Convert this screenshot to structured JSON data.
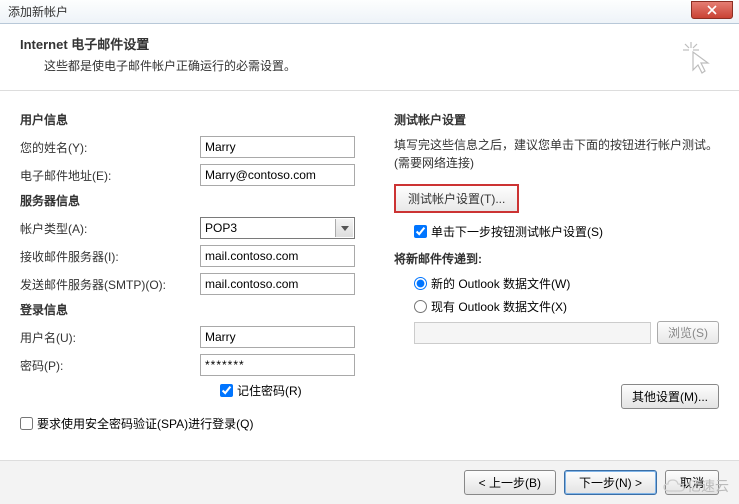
{
  "window": {
    "title": "添加新帐户"
  },
  "header": {
    "title": "Internet 电子邮件设置",
    "subtitle": "这些都是使电子邮件帐户正确运行的必需设置。"
  },
  "left": {
    "section_user": "用户信息",
    "name_label": "您的姓名(Y):",
    "name_value": "Marry",
    "email_label": "电子邮件地址(E):",
    "email_value": "Marry@contoso.com",
    "section_server": "服务器信息",
    "acct_type_label": "帐户类型(A):",
    "acct_type_value": "POP3",
    "incoming_label": "接收邮件服务器(I):",
    "incoming_value": "mail.contoso.com",
    "outgoing_label": "发送邮件服务器(SMTP)(O):",
    "outgoing_value": "mail.contoso.com",
    "section_login": "登录信息",
    "user_label": "用户名(U):",
    "user_value": "Marry",
    "pw_label": "密码(P):",
    "pw_value": "*******",
    "remember_pw": "记住密码(R)",
    "spa_label": "要求使用安全密码验证(SPA)进行登录(Q)"
  },
  "right": {
    "section_test": "测试帐户设置",
    "test_desc": "填写完这些信息之后，建议您单击下面的按钮进行帐户测试。(需要网络连接)",
    "test_btn": "测试帐户设置(T)...",
    "test_auto": "单击下一步按钮测试帐户设置(S)",
    "section_deliver": "将新邮件传递到:",
    "radio_new": "新的 Outlook 数据文件(W)",
    "radio_existing": "现有 Outlook 数据文件(X)",
    "browse_btn": "浏览(S)",
    "more_btn": "其他设置(M)..."
  },
  "footer": {
    "back": "< 上一步(B)",
    "next": "下一步(N) >",
    "cancel": "取消"
  },
  "watermark": "亿速云"
}
